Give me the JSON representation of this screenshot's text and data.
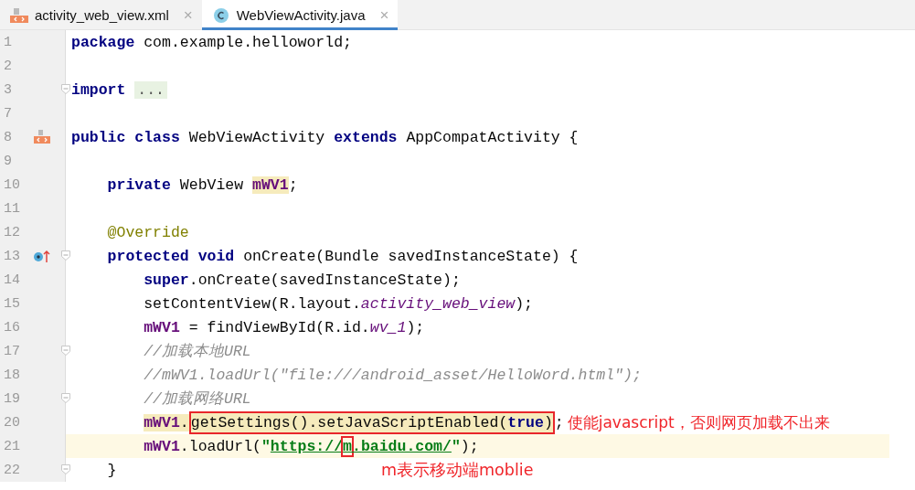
{
  "tabs": [
    {
      "label": "activity_web_view.xml",
      "kind": "xml",
      "selected": false,
      "close": "×"
    },
    {
      "label": "WebViewActivity.java",
      "kind": "class",
      "selected": true,
      "close": "×"
    }
  ],
  "lines": [
    {
      "number": "1",
      "tokens": [
        {
          "kind": "keyword",
          "text": "package"
        },
        {
          "kind": "plain",
          "text": " com.example.helloworld;"
        }
      ]
    },
    {
      "number": "2"
    },
    {
      "number": "3",
      "fold": true,
      "tokens": [
        {
          "kind": "keyword",
          "text": "import"
        },
        {
          "kind": "folded",
          "text": "..."
        }
      ]
    },
    {
      "number": "7"
    },
    {
      "number": "8",
      "gutter_icon": {
        "kind": "xml"
      },
      "tokens": [
        {
          "kind": "keyword",
          "text": "public class"
        },
        {
          "kind": "plain",
          "text": " WebViewActivity "
        },
        {
          "kind": "keyword",
          "text": "extends"
        },
        {
          "kind": "plain",
          "text": " AppCompatActivity {"
        }
      ]
    },
    {
      "number": "9"
    },
    {
      "number": "10",
      "tokens": [
        {
          "kind": "keyword",
          "text": "    private"
        },
        {
          "kind": "plain",
          "text": " WebView "
        },
        {
          "kind": "field",
          "text": "mWV1",
          "highlighted": true
        },
        {
          "kind": "plain",
          "text": ";"
        }
      ]
    },
    {
      "number": "11"
    },
    {
      "number": "12",
      "tokens": [
        {
          "kind": "annotation",
          "text": "    @Override"
        }
      ]
    },
    {
      "number": "13",
      "gutter_icon": {
        "kind": "override"
      },
      "fold": true,
      "tokens": [
        {
          "kind": "keyword",
          "text": "    protected void"
        },
        {
          "kind": "plain",
          "text": " onCreate(Bundle savedInstanceState) {"
        }
      ]
    },
    {
      "number": "14",
      "tokens": [
        {
          "kind": "keyword",
          "text": "        super"
        },
        {
          "kind": "plain",
          "text": ".onCreate(savedInstanceState);"
        }
      ]
    },
    {
      "number": "15",
      "tokens": [
        {
          "kind": "plain",
          "text": "        setContentView(R.layout."
        },
        {
          "kind": "static",
          "text": "activity_web_view"
        },
        {
          "kind": "plain",
          "text": ");"
        }
      ]
    },
    {
      "number": "16",
      "tokens": [
        {
          "kind": "field",
          "text": "        mWV1"
        },
        {
          "kind": "plain",
          "text": " = findViewById(R.id."
        },
        {
          "kind": "static",
          "text": "wv_1"
        },
        {
          "kind": "plain",
          "text": ");"
        }
      ]
    },
    {
      "number": "17",
      "fold": true,
      "tokens": [
        {
          "kind": "comment",
          "text": "        //加载本地URL"
        }
      ]
    },
    {
      "number": "18",
      "tokens": [
        {
          "kind": "comment",
          "text": "        //mWV1.loadUrl(\"file:///android_asset/HelloWord.html\");"
        }
      ]
    },
    {
      "number": "19",
      "fold": true,
      "tokens": [
        {
          "kind": "comment",
          "text": "        //加载网络URL"
        }
      ]
    },
    {
      "number": "20",
      "tokens": [
        {
          "kind": "field",
          "text": "        mWV1",
          "highlighted": true
        },
        {
          "kind": "plain",
          "text": ".",
          "highlighted": true
        },
        {
          "kind": "plain",
          "text": "getSettings().setJavaScriptEnabled(",
          "highlighted": true,
          "boxed": true
        },
        {
          "kind": "keyword",
          "text": "true",
          "highlighted": true,
          "boxed": true
        },
        {
          "kind": "plain",
          "text": ")",
          "highlighted": true,
          "boxed": true
        },
        {
          "kind": "plain",
          "text": ";"
        }
      ],
      "note": "使能javascript，否则网页加载不出来"
    },
    {
      "number": "21",
      "current": true,
      "tokens": [
        {
          "kind": "field",
          "text": "        mWV1"
        },
        {
          "kind": "plain",
          "text": ".loadUrl("
        },
        {
          "kind": "string",
          "text": "\""
        },
        {
          "kind": "url",
          "text": "https://"
        },
        {
          "kind": "url",
          "text": "m",
          "boxed": true
        },
        {
          "kind": "url",
          "text": ".baidu.com/"
        },
        {
          "kind": "string",
          "text": "\""
        },
        {
          "kind": "plain",
          "text": ");"
        }
      ]
    },
    {
      "number": "22",
      "fold": true,
      "tokens": [
        {
          "kind": "plain",
          "text": "    }"
        }
      ],
      "note_below": "m表示移动端moblie"
    }
  ]
}
